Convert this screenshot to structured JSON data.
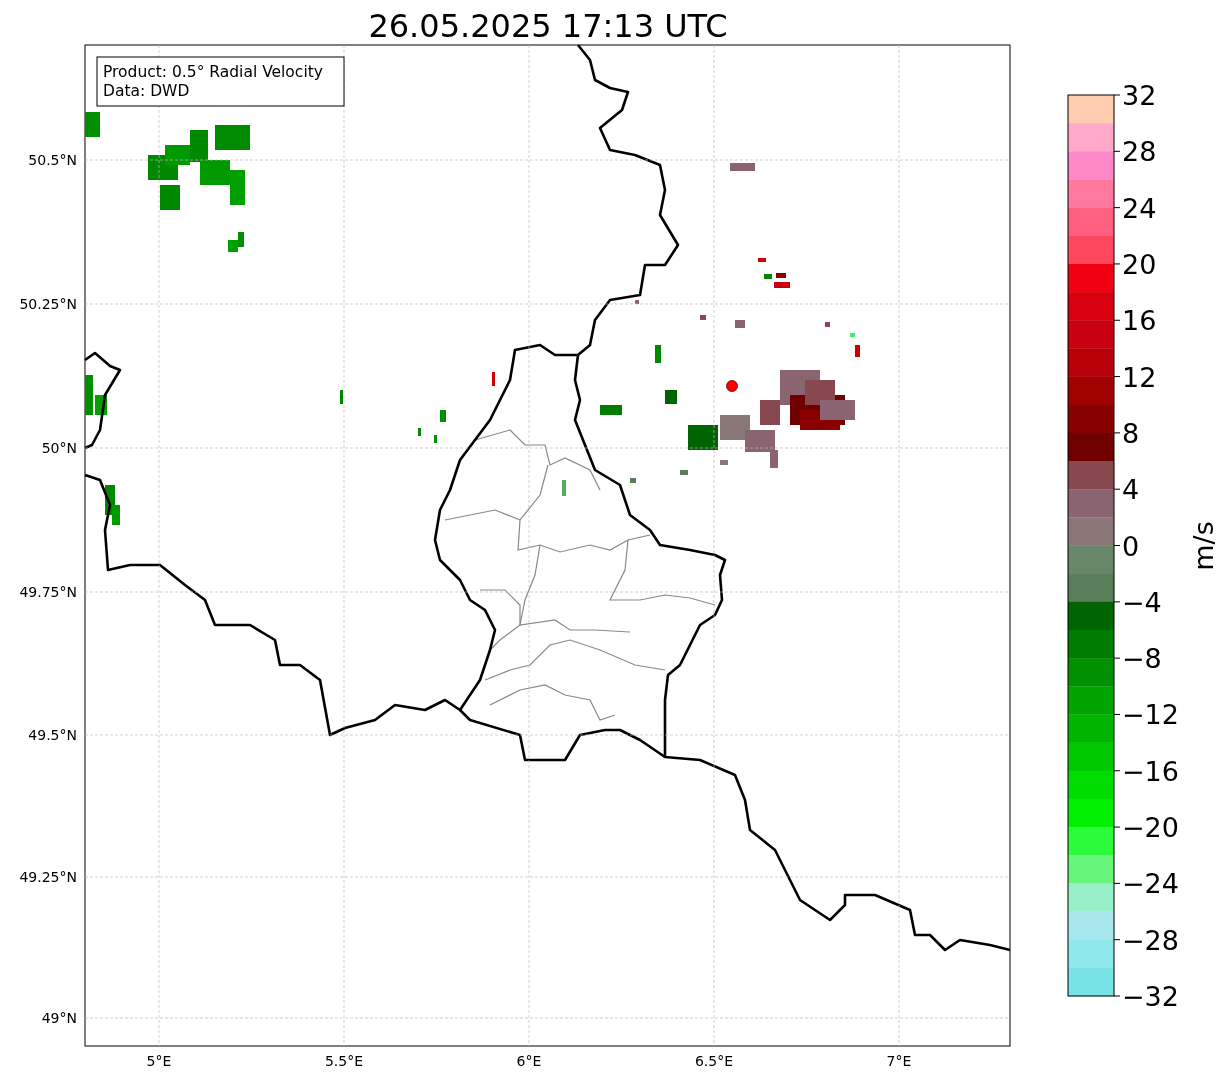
{
  "title": "26.05.2025 17:13 UTC",
  "info_box": {
    "lines": [
      "Product: 0.5° Radial Velocity",
      "Data: DWD"
    ]
  },
  "map": {
    "lat_ticks": [
      "50.5°N",
      "50.25°N",
      "50°N",
      "49.75°N",
      "49.5°N",
      "49.25°N",
      "49°N"
    ],
    "lon_ticks": [
      "5°E",
      "5.5°E",
      "6°E",
      "6.5°E",
      "7°E"
    ]
  },
  "colorbar": {
    "label": "m/s",
    "ticks": [
      "32",
      "28",
      "24",
      "20",
      "16",
      "12",
      "8",
      "4",
      "0",
      "−4",
      "−8",
      "−12",
      "−16",
      "−20",
      "−24",
      "−28",
      "−32"
    ],
    "segments": [
      {
        "color": "#ffccb0"
      },
      {
        "color": "#ffa8c8"
      },
      {
        "color": "#ff88c8"
      },
      {
        "color": "#ff78a0"
      },
      {
        "color": "#ff6080"
      },
      {
        "color": "#ff4860"
      },
      {
        "color": "#f00010"
      },
      {
        "color": "#d80010"
      },
      {
        "color": "#c80010"
      },
      {
        "color": "#b80008"
      },
      {
        "color": "#a00000"
      },
      {
        "color": "#880000"
      },
      {
        "color": "#700000"
      },
      {
        "color": "#884850"
      },
      {
        "color": "#8a6470"
      },
      {
        "color": "#8a7878"
      },
      {
        "color": "#6a866a"
      },
      {
        "color": "#5a7e5a"
      },
      {
        "color": "#006400"
      },
      {
        "color": "#007c00"
      },
      {
        "color": "#009000"
      },
      {
        "color": "#00a400"
      },
      {
        "color": "#00b400"
      },
      {
        "color": "#00c800"
      },
      {
        "color": "#00dc00"
      },
      {
        "color": "#00f000"
      },
      {
        "color": "#2cfb3c"
      },
      {
        "color": "#66f47a"
      },
      {
        "color": "#98f0c8"
      },
      {
        "color": "#a8e8ec"
      },
      {
        "color": "#8ee8ec"
      },
      {
        "color": "#78e4e8"
      }
    ]
  }
}
